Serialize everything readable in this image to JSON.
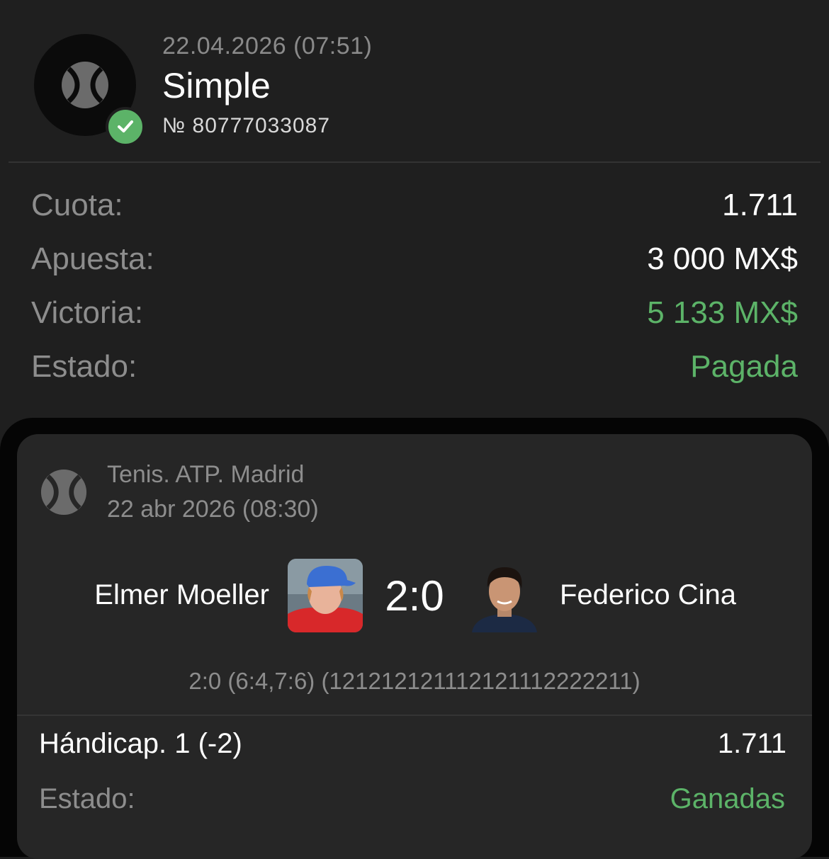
{
  "bet": {
    "date": "22.04.2026 (07:51)",
    "type": "Simple",
    "number": "№ 80777033087"
  },
  "summary": [
    {
      "label": "Cuota:",
      "value": "1.711",
      "color": "#ffffff"
    },
    {
      "label": "Apuesta:",
      "value": "3 000 MX$",
      "color": "#ffffff"
    },
    {
      "label": "Victoria:",
      "value": "5 133 MX$",
      "color": "#5cb368"
    },
    {
      "label": "Estado:",
      "value": "Pagada",
      "color": "#5cb368"
    }
  ],
  "event": {
    "league": "Tenis. ATP. Madrid",
    "date": "22 abr 2026 (08:30)",
    "player_home": "Elmer Moeller",
    "player_away": "Federico Cina",
    "score": "2:0",
    "set_score": "2:0 (6:4,7:6) (121212121112121112222211)",
    "market": "Hándicap. 1 (-2)",
    "odds": "1.711",
    "status_label": "Estado:",
    "status_value": "Ganadas"
  },
  "icons": {
    "sport": "tennis-ball-icon",
    "badge": "check-circle-icon"
  },
  "colors": {
    "background": "#1f1f1f",
    "card": "#262626",
    "accent_green": "#5cb368",
    "muted_text": "#8d8d8d"
  }
}
